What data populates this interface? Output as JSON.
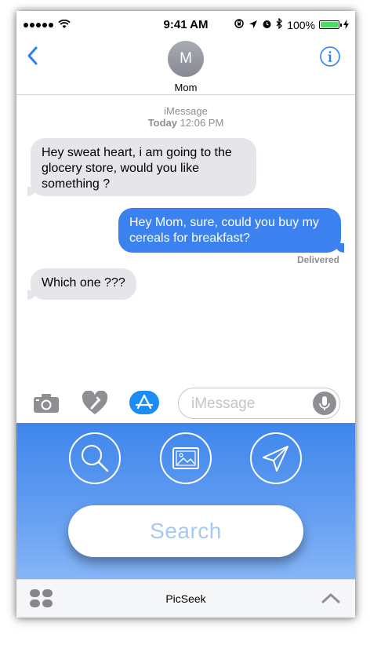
{
  "status_bar": {
    "signal_dots": 5,
    "time": "9:41 AM",
    "battery": "100%",
    "battery_level": 1.0,
    "icons": [
      "wifi-icon",
      "rotation-lock-icon",
      "location-icon",
      "alarm-icon",
      "bluetooth-icon",
      "charging-icon"
    ]
  },
  "header": {
    "avatar_initial": "M",
    "contact_name": "Mom",
    "back_icon": "chevron-left-icon",
    "info_icon": "info-icon"
  },
  "thread": {
    "service": "iMessage",
    "date_prefix": "Today",
    "time": "12:06 PM",
    "messages": [
      {
        "direction": "incoming",
        "lines": [
          "Hey sweat heart, i am going to the",
          "glocery store, would you like",
          "something ?"
        ]
      },
      {
        "direction": "outgoing",
        "lines": [
          "Hey Mom, sure, could you buy my",
          "cereals for breakfast?"
        ]
      },
      {
        "direction": "incoming",
        "lines": [
          "Which one ???"
        ]
      }
    ],
    "delivered_label": "Delivered"
  },
  "input_bar": {
    "placeholder": "iMessage",
    "icons": [
      "camera-icon",
      "digital-touch-heart-icon",
      "app-store-icon",
      "microphone-icon"
    ]
  },
  "picseek_panel": {
    "buttons": [
      "search-icon",
      "image-icon",
      "send-icon"
    ],
    "search_label": "Search"
  },
  "bottom_bar": {
    "app_name": "PicSeek",
    "icons": [
      "app-drawer-icon",
      "chevron-up-icon"
    ]
  },
  "colors": {
    "accent": "#3b82f0",
    "incoming_bubble": "#e5e5ea",
    "panel_top": "#3f86ec",
    "panel_bottom": "#86b5f8"
  }
}
